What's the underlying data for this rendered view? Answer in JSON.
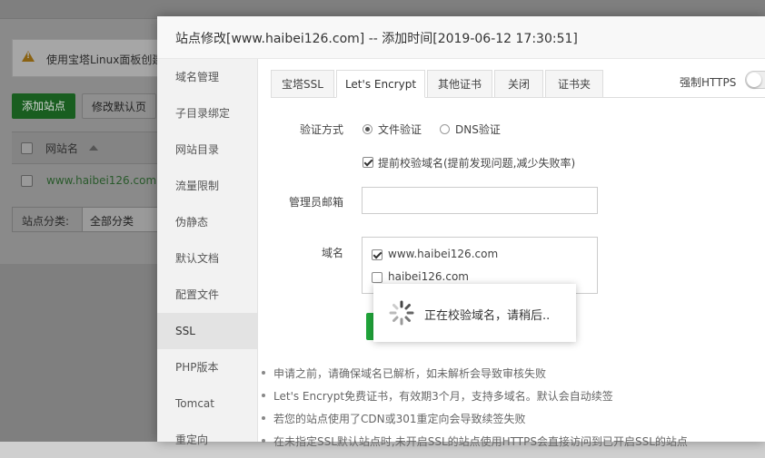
{
  "background": {
    "warning_text": "使用宝塔Linux面板创建",
    "add_site_button": "添加站点",
    "modify_default_button": "修改默认页",
    "table_header_sitename": "网站名",
    "site_row_name": "www.haibei126.com",
    "filter_label": "站点分类:",
    "filter_value": "全部分类"
  },
  "modal": {
    "title": "站点修改[www.haibei126.com] -- 添加时间[2019-06-12 17:30:51]",
    "sidebar": [
      {
        "label": "域名管理"
      },
      {
        "label": "子目录绑定"
      },
      {
        "label": "网站目录"
      },
      {
        "label": "流量限制"
      },
      {
        "label": "伪静态"
      },
      {
        "label": "默认文档"
      },
      {
        "label": "配置文件"
      },
      {
        "label": "SSL",
        "active": true
      },
      {
        "label": "PHP版本"
      },
      {
        "label": "Tomcat"
      },
      {
        "label": "重定向"
      }
    ],
    "tabs": [
      {
        "label": "宝塔SSL"
      },
      {
        "label": "Let's Encrypt",
        "active": true
      },
      {
        "label": "其他证书"
      },
      {
        "label": "关闭"
      },
      {
        "label": "证书夹"
      }
    ],
    "force_https_label": "强制HTTPS",
    "force_https_on": false,
    "form": {
      "verify_label": "验证方式",
      "verify_file": "文件验证",
      "verify_dns": "DNS验证",
      "verify_selected": "file",
      "precheck_label": "提前校验域名(提前发现问题,减少失败率)",
      "precheck_checked": true,
      "email_label": "管理员邮箱",
      "email_value": "",
      "domain_label": "域名",
      "domains": [
        {
          "name": "www.haibei126.com",
          "checked": true
        },
        {
          "name": "haibei126.com",
          "checked": false
        }
      ]
    },
    "tips": [
      "申请之前，请确保域名已解析，如未解析会导致审核失败",
      "Let's Encrypt免费证书，有效期3个月，支持多域名。默认会自动续签",
      "若您的站点使用了CDN或301重定向会导致续签失败",
      "在未指定SSL默认站点时,未开启SSL的站点使用HTTPS会直接访问到已开启SSL的站点"
    ]
  },
  "loading": {
    "message": "正在校验域名，请稍后.."
  },
  "colors": {
    "accent_green": "#20a53a",
    "overlay": "#7f7f7f"
  }
}
